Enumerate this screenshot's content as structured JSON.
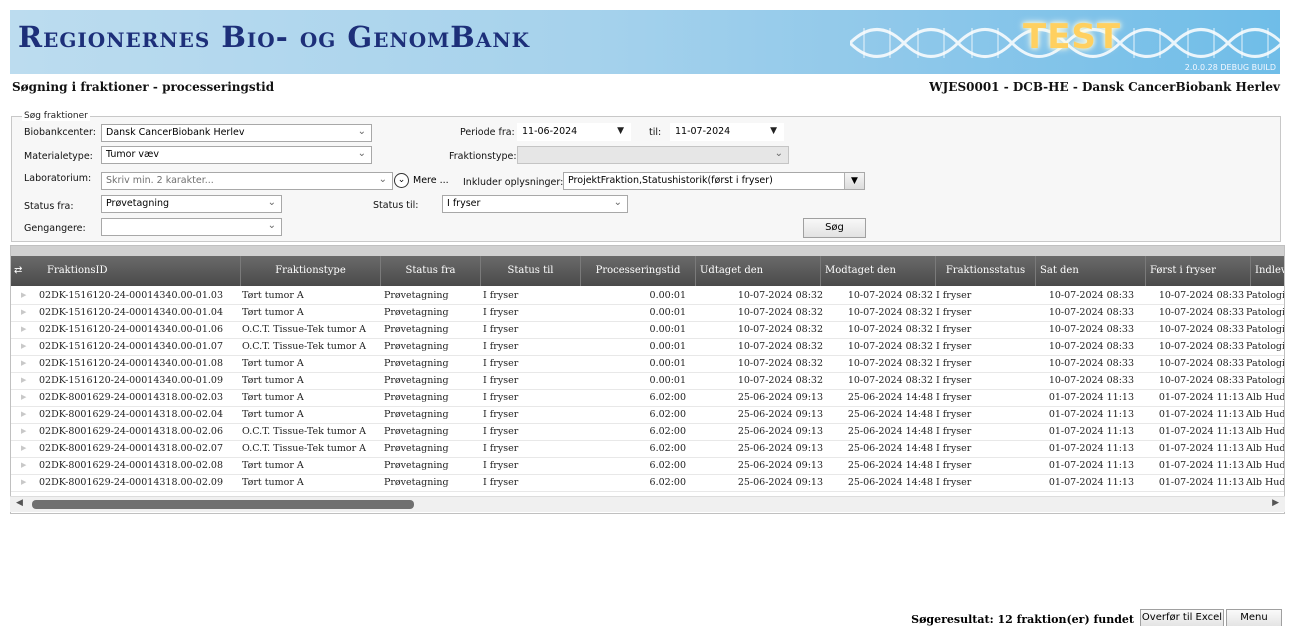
{
  "app": {
    "banner_title": "Regionernes Bio- og GenomBank",
    "test_label": "TEST",
    "build": "2.0.0.28 DEBUG BUILD",
    "page_title": "Søgning i fraktioner - processeringstid",
    "user_context": "WJES0001 - DCB-HE - Dansk CancerBiobank Herlev"
  },
  "search": {
    "legend": "Søg fraktioner",
    "biobankcenter_label": "Biobankcenter:",
    "biobankcenter_value": "Dansk CancerBiobank Herlev",
    "materialetype_label": "Materialetype:",
    "materialetype_value": "Tumor væv",
    "laboratorium_label": "Laboratorium:",
    "laboratorium_placeholder": "Skriv min. 2 karakter...",
    "mere_label": "Mere ...",
    "status_fra_label": "Status fra:",
    "status_fra_value": "Prøvetagning",
    "gengangere_label": "Gengangere:",
    "gengangere_value": "",
    "periode_fra_label": "Periode fra:",
    "periode_fra_value": "11-06-2024",
    "til_label": "til:",
    "til_value": "11-07-2024",
    "fraktionstype_label": "Fraktionstype:",
    "fraktionstype_value": "",
    "inkluder_label": "Inkluder oplysninger:",
    "inkluder_value": "ProjektFraktion,Statushistorik(først i fryser)",
    "status_til_label": "Status til:",
    "status_til_value": "I fryser",
    "search_button": "Søg"
  },
  "grid": {
    "columns": [
      "FraktionsID",
      "Fraktionstype",
      "Status fra",
      "Status til",
      "Processeringstid",
      "Udtaget den",
      "Modtaget den",
      "Fraktionsstatus",
      "Sat den",
      "Først i fryser",
      "Indleve"
    ],
    "rows": [
      [
        "02DK-1516120-24-00014340.00-01.03",
        "Tørt tumor A",
        "Prøvetagning",
        "I fryser",
        "0.00:01",
        "10-07-2024 08:32",
        "10-07-2024 08:32",
        "I fryser",
        "10-07-2024 08:33",
        "10-07-2024 08:33",
        "Patologi"
      ],
      [
        "02DK-1516120-24-00014340.00-01.04",
        "Tørt tumor A",
        "Prøvetagning",
        "I fryser",
        "0.00:01",
        "10-07-2024 08:32",
        "10-07-2024 08:32",
        "I fryser",
        "10-07-2024 08:33",
        "10-07-2024 08:33",
        "Patologi"
      ],
      [
        "02DK-1516120-24-00014340.00-01.06",
        "O.C.T. Tissue-Tek tumor A",
        "Prøvetagning",
        "I fryser",
        "0.00:01",
        "10-07-2024 08:32",
        "10-07-2024 08:32",
        "I fryser",
        "10-07-2024 08:33",
        "10-07-2024 08:33",
        "Patologi"
      ],
      [
        "02DK-1516120-24-00014340.00-01.07",
        "O.C.T. Tissue-Tek tumor A",
        "Prøvetagning",
        "I fryser",
        "0.00:01",
        "10-07-2024 08:32",
        "10-07-2024 08:32",
        "I fryser",
        "10-07-2024 08:33",
        "10-07-2024 08:33",
        "Patologi"
      ],
      [
        "02DK-1516120-24-00014340.00-01.08",
        "Tørt tumor A",
        "Prøvetagning",
        "I fryser",
        "0.00:01",
        "10-07-2024 08:32",
        "10-07-2024 08:32",
        "I fryser",
        "10-07-2024 08:33",
        "10-07-2024 08:33",
        "Patologi"
      ],
      [
        "02DK-1516120-24-00014340.00-01.09",
        "Tørt tumor A",
        "Prøvetagning",
        "I fryser",
        "0.00:01",
        "10-07-2024 08:32",
        "10-07-2024 08:32",
        "I fryser",
        "10-07-2024 08:33",
        "10-07-2024 08:33",
        "Patologi"
      ],
      [
        "02DK-8001629-24-00014318.00-02.03",
        "Tørt tumor A",
        "Prøvetagning",
        "I fryser",
        "6.02:00",
        "25-06-2024 09:13",
        "25-06-2024 14:48",
        "I fryser",
        "01-07-2024 11:13",
        "01-07-2024 11:13",
        "Alb Hud-"
      ],
      [
        "02DK-8001629-24-00014318.00-02.04",
        "Tørt tumor A",
        "Prøvetagning",
        "I fryser",
        "6.02:00",
        "25-06-2024 09:13",
        "25-06-2024 14:48",
        "I fryser",
        "01-07-2024 11:13",
        "01-07-2024 11:13",
        "Alb Hud-"
      ],
      [
        "02DK-8001629-24-00014318.00-02.06",
        "O.C.T. Tissue-Tek tumor A",
        "Prøvetagning",
        "I fryser",
        "6.02:00",
        "25-06-2024 09:13",
        "25-06-2024 14:48",
        "I fryser",
        "01-07-2024 11:13",
        "01-07-2024 11:13",
        "Alb Hud-"
      ],
      [
        "02DK-8001629-24-00014318.00-02.07",
        "O.C.T. Tissue-Tek tumor A",
        "Prøvetagning",
        "I fryser",
        "6.02:00",
        "25-06-2024 09:13",
        "25-06-2024 14:48",
        "I fryser",
        "01-07-2024 11:13",
        "01-07-2024 11:13",
        "Alb Hud-"
      ],
      [
        "02DK-8001629-24-00014318.00-02.08",
        "Tørt tumor A",
        "Prøvetagning",
        "I fryser",
        "6.02:00",
        "25-06-2024 09:13",
        "25-06-2024 14:48",
        "I fryser",
        "01-07-2024 11:13",
        "01-07-2024 11:13",
        "Alb Hud-"
      ],
      [
        "02DK-8001629-24-00014318.00-02.09",
        "Tørt tumor A",
        "Prøvetagning",
        "I fryser",
        "6.02:00",
        "25-06-2024 09:13",
        "25-06-2024 14:48",
        "I fryser",
        "01-07-2024 11:13",
        "01-07-2024 11:13",
        "Alb Hud-"
      ]
    ]
  },
  "footer": {
    "result_text": "Søgeresultat: 12 fraktion(er) fundet",
    "excel_button": "Overfør til Excel",
    "menu_button": "Menu"
  },
  "icons": {
    "dropdown": "chevron-down-icon",
    "expand": "circle-chevron-down-icon",
    "grid_options": "column-chooser-icon",
    "row_marker": "row-indicator-icon"
  },
  "colors": {
    "banner_title": "#1d2f79",
    "test_label": "#ffd060",
    "grid_header": "#555555"
  }
}
